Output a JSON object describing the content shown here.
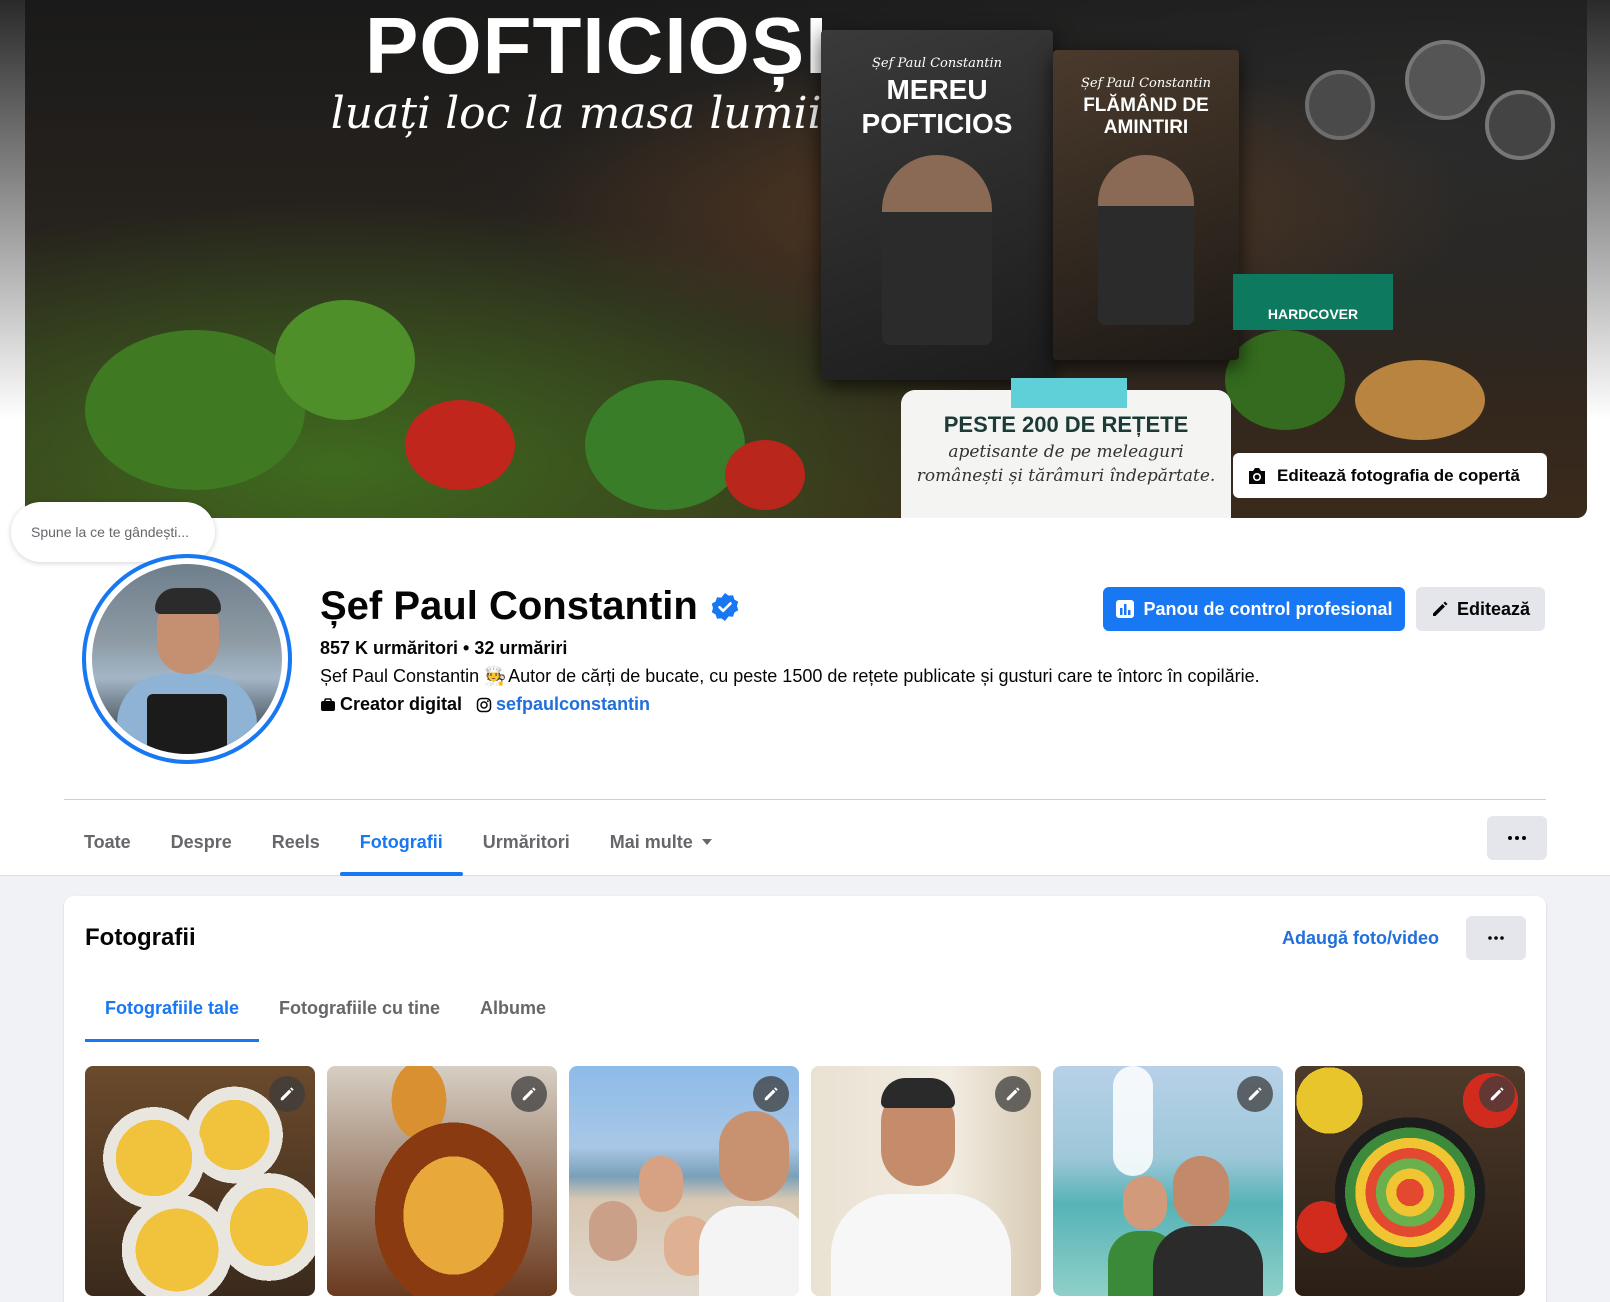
{
  "cover": {
    "headline": "POFTICIOȘI,",
    "subline": "luați loc la masa lumii!",
    "book1": {
      "author": "Șef Paul Constantin",
      "title_line1": "MEREU",
      "title_line2": "POFTICIOS"
    },
    "book2": {
      "author": "Șef Paul Constantin",
      "title": "FLĂMÂND DE AMINTIRI"
    },
    "badge": "HARDCOVER",
    "banner": {
      "title": "PESTE 200 DE REȚETE",
      "line1": "apetisante de pe meleaguri",
      "line2": "românești și tărâmuri îndepărtate."
    },
    "edit_button_label": "Editează fotografia de copertă"
  },
  "thought_bubble": "Spune la ce te gândești...",
  "profile": {
    "name": "Șef Paul Constantin",
    "stats": "857 K urmăritori • 32 urmăriri",
    "bio_name": "Șef Paul Constantin",
    "bio_emoji": "🧑‍🍳",
    "bio_text": "Autor de cărți de bucate, cu peste 1500 de rețete publicate și gusturi care te întorc în copilărie.",
    "category": "Creator digital",
    "instagram": "sefpaulconstantin"
  },
  "actions": {
    "dashboard_label": "Panou de control profesional",
    "edit_label": "Editează"
  },
  "tabs": [
    {
      "label": "Toate",
      "active": false
    },
    {
      "label": "Despre",
      "active": false
    },
    {
      "label": "Reels",
      "active": false
    },
    {
      "label": "Fotografii",
      "active": true
    },
    {
      "label": "Urmăritori",
      "active": false
    },
    {
      "label": "Mai multe",
      "active": false
    }
  ],
  "photos_card": {
    "title": "Fotografii",
    "add_label": "Adaugă foto/video",
    "subtabs": [
      {
        "label": "Fotografiile tale",
        "active": true
      },
      {
        "label": "Fotografiile cu tine",
        "active": false
      },
      {
        "label": "Albume",
        "active": false
      }
    ]
  },
  "colors": {
    "accent": "#1877f2",
    "link": "#216fdb",
    "page_bg": "#f0f2f5"
  }
}
